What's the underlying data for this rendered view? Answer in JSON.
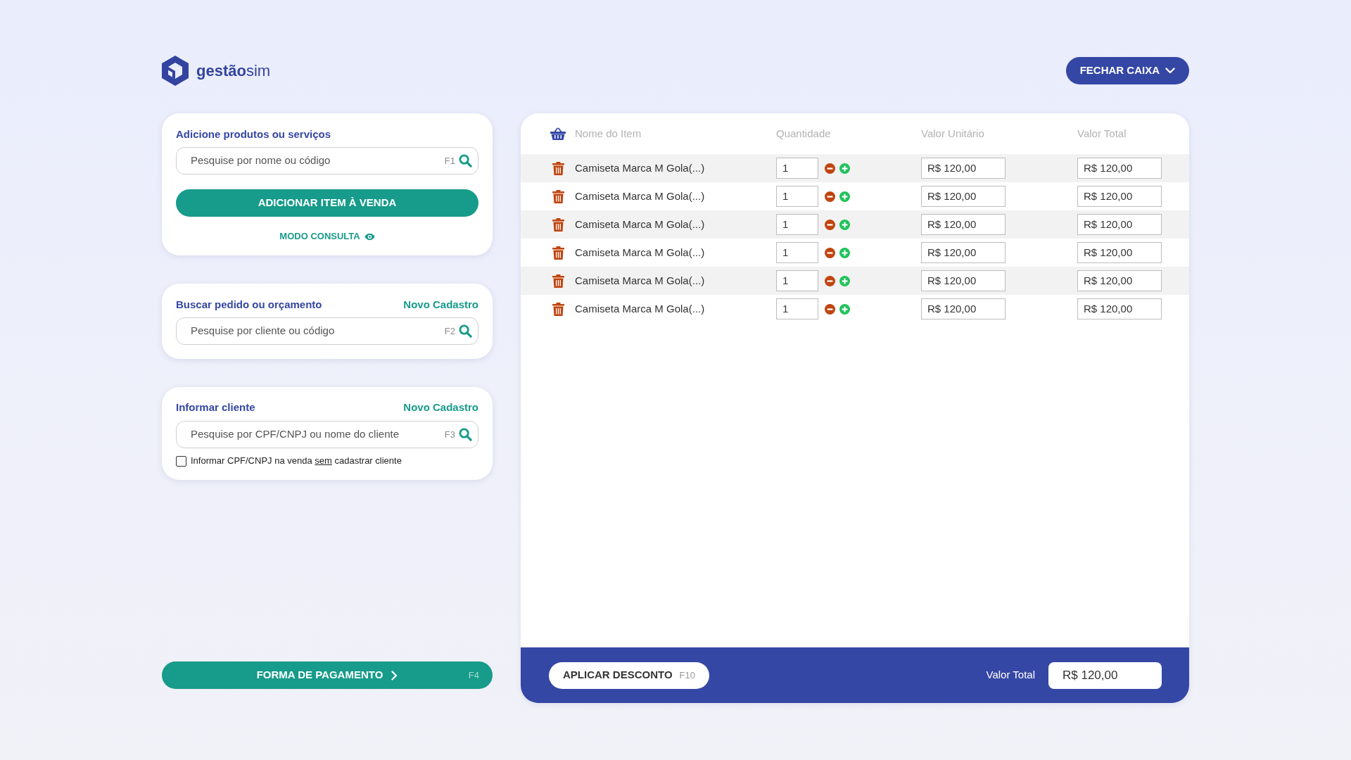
{
  "brand": "**gestão**sim",
  "header": {
    "close_register_button": "FECHAR CAIXA"
  },
  "product_search": {
    "title": "Adicione produtos ou serviços",
    "search": {
      "placeholder": "Pesquise por nome ou código",
      "shortcut": "F1"
    },
    "add_button": "ADICIONAR ITEM À VENDA",
    "consult_link": "MODO CONSULTA"
  },
  "order_search": {
    "title": "Buscar pedido ou orçamento",
    "new_link": "Novo Cadastro",
    "search": {
      "placeholder": "Pesquise por cliente ou código",
      "shortcut": "F2"
    }
  },
  "client": {
    "title": "Informar cliente",
    "new_link": "Novo Cadastro",
    "search": {
      "placeholder": "Pesquise por CPF/CNPJ ou nome do cliente",
      "shortcut": "F3"
    },
    "no_register": {
      "checked": false,
      "label_before": "Informar CPF/CNPJ na venda",
      "label_underlined": "sem",
      "label_after": "cadastrar cliente"
    }
  },
  "payment_button": {
    "label": "FORMA DE PAGAMENTO",
    "shortcut": "F4"
  },
  "table": {
    "columns": [
      "Nome do Item",
      "Quantidade",
      "Valor Unitário",
      "Valor Total"
    ],
    "rows": [
      {
        "name": "Camiseta Marca M Gola(...)",
        "quantity": "1",
        "unit_price": "R$ 120,00",
        "total": "R$ 120,00"
      },
      {
        "name": "Camiseta Marca M Gola(...)",
        "quantity": "1",
        "unit_price": "R$ 120,00",
        "total": "R$ 120,00"
      },
      {
        "name": "Camiseta Marca M Gola(...)",
        "quantity": "1",
        "unit_price": "R$ 120,00",
        "total": "R$ 120,00"
      },
      {
        "name": "Camiseta Marca M Gola(...)",
        "quantity": "1",
        "unit_price": "R$ 120,00",
        "total": "R$ 120,00"
      },
      {
        "name": "Camiseta Marca M Gola(...)",
        "quantity": "1",
        "unit_price": "R$ 120,00",
        "total": "R$ 120,00"
      },
      {
        "name": "Camiseta Marca M Gola(...)",
        "quantity": "1",
        "unit_price": "R$ 120,00",
        "total": "R$ 120,00"
      }
    ]
  },
  "footer": {
    "discount_button": {
      "label": "APLICAR DESCONTO",
      "shortcut": "F10"
    },
    "total": {
      "label": "Valor Total",
      "value": "R$ 120,00"
    }
  }
}
